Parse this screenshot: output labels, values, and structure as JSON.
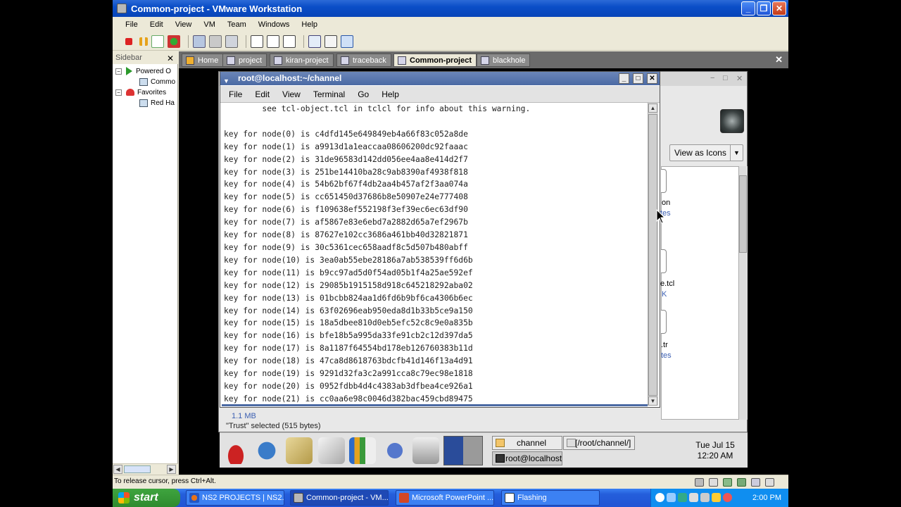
{
  "vmware": {
    "title": "Common-project - VMware Workstation",
    "menu": [
      "File",
      "Edit",
      "View",
      "VM",
      "Team",
      "Windows",
      "Help"
    ],
    "sidebar": {
      "header": "Sidebar",
      "items": [
        "Powered O",
        "Commo",
        "Favorites",
        "Red Ha"
      ]
    },
    "tabs": [
      "Home",
      "project",
      "kiran-project",
      "traceback",
      "Common-project",
      "blackhole"
    ],
    "active_tab": "Common-project",
    "status_text": "To release cursor, press Ctrl+Alt."
  },
  "terminal": {
    "title": "root@localhost:~/channel",
    "menu": [
      "File",
      "Edit",
      "View",
      "Terminal",
      "Go",
      "Help"
    ],
    "lines": [
      "        see tcl-object.tcl in tclcl for info about this warning.",
      "",
      "key for node(0) is c4dfd145e649849eb4a66f83c052a8de",
      "key for node(1) is a9913d1a1eaccaa08606200dc92faaac",
      "key for node(2) is 31de96583d142dd056ee4aa8e414d2f7",
      "key for node(3) is 251be14410ba28c9ab8390af4938f818",
      "key for node(4) is 54b62bf67f4db2aa4b457af2f3aa074a",
      "key for node(5) is cc651450d37686b8e50907e24e777408",
      "key for node(6) is f109638ef552198f3ef39ec6ec63df90",
      "key for node(7) is af5867e83e6ebd7a2882d65a7ef2967b",
      "key for node(8) is 87627e102cc3686a461bb40d32821871",
      "key for node(9) is 30c5361cec658aadf8c5d507b480abff",
      "key for node(10) is 3ea0ab55ebe28186a7ab538539ff6d6b",
      "key for node(11) is b9cc97ad5d0f54ad05b1f4a25ae592ef",
      "key for node(12) is 29085b1915158d918c645218292aba02",
      "key for node(13) is 01bcbb824aa1d6fd6b9bf6ca4306b6ec",
      "key for node(14) is 63f02696eab950eda8d1b33b5ce9a150",
      "key for node(15) is 18a5dbee810d0eb5efc52c8c9e0a835b",
      "key for node(16) is bfe18b5a995da33fe91cb2c12d397da5",
      "key for node(17) is 8a1187f64554bd178eb126760383b11d",
      "key for node(18) is 47ca8d8618763bdcfb41d146f13a4d91",
      "key for node(19) is 9291d32fa3c2a991cca8c79ec98e1818",
      "key for node(20) is 0952fdbb4d4c4383ab3dfbea4ce926a1",
      "key for node(21) is cc0aa6e98c0046d382bac459cbd89475"
    ]
  },
  "nautilus": {
    "view_as": "View as Icons",
    "files": [
      {
        "name": "on",
        "sub": "tes"
      },
      {
        "name": "e.tcl",
        "sub": "K"
      },
      {
        "name": ".tr",
        "sub": "tes"
      }
    ],
    "size_text": "1.1 MB",
    "status": "\"Trust\" selected (515 bytes)"
  },
  "guest_panel": {
    "windows": [
      "channel",
      "[/root/channel/]",
      "root@localhost"
    ],
    "clock_line1": "Tue Jul 15",
    "clock_line2": "12:20 AM"
  },
  "taskbar": {
    "start": "start",
    "tasks": [
      "NS2 PROJECTS | NS2...",
      "Common-project - VM...",
      "Microsoft PowerPoint ...",
      "Flashing"
    ],
    "time": "2:00 PM"
  },
  "colors": {
    "xp_blue": "#0a4ec7",
    "terminal_title": "#4b6aa4",
    "start_green": "#2e8b2e"
  }
}
